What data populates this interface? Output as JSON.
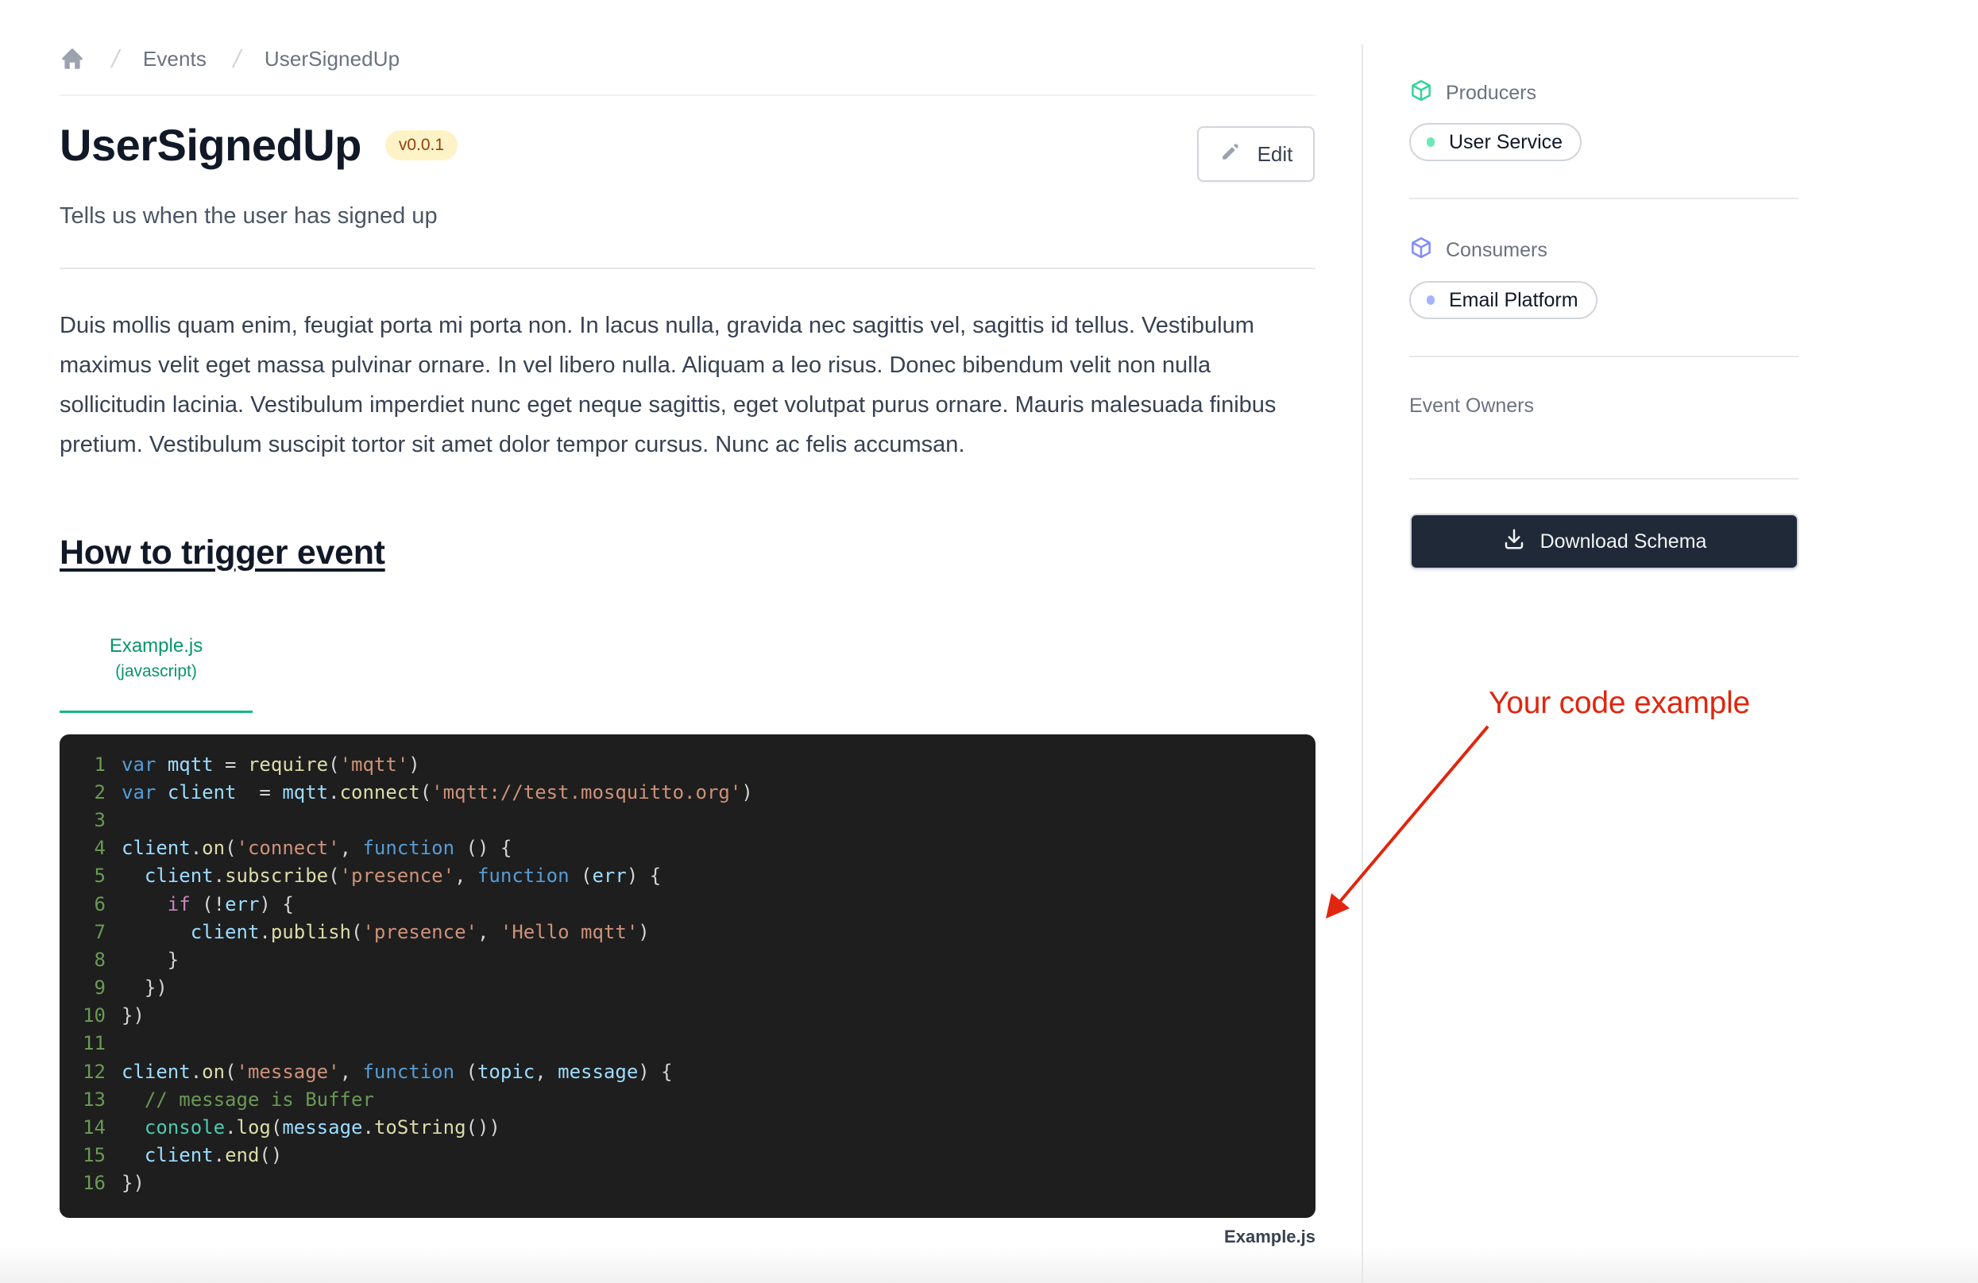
{
  "breadcrumb": {
    "home_icon": "home-icon",
    "separator": "/",
    "items": [
      "Events",
      "UserSignedUp"
    ]
  },
  "header": {
    "title": "UserSignedUp",
    "version": "v0.0.1",
    "edit_label": "Edit",
    "edit_icon": "pencil-icon",
    "summary": "Tells us when the user has signed up"
  },
  "body": {
    "paragraph": "Duis mollis quam enim, feugiat porta mi porta non. In lacus nulla, gravida nec sagittis vel, sagittis id tellus. Vestibulum maximus velit eget massa pulvinar ornare. In vel libero nulla. Aliquam a leo risus. Donec bibendum velit non nulla sollicitudin lacinia. Vestibulum imperdiet nunc eget neque sagittis, eget volutpat purus ornare. Mauris malesuada finibus pretium. Vestibulum suscipit tortor sit amet dolor tempor cursus. Nunc ac felis accumsan.",
    "section_heading": "How to trigger event"
  },
  "code_example": {
    "tab_name": "Example.js",
    "tab_language": "(javascript)",
    "caption": "Example.js",
    "lines": [
      [
        [
          "kw",
          "var"
        ],
        [
          "p",
          " "
        ],
        [
          "var",
          "mqtt"
        ],
        [
          "p",
          " = "
        ],
        [
          "fn",
          "require"
        ],
        [
          "p",
          "("
        ],
        [
          "str",
          "'mqtt'"
        ],
        [
          "p",
          ")"
        ]
      ],
      [
        [
          "kw",
          "var"
        ],
        [
          "p",
          " "
        ],
        [
          "var",
          "client"
        ],
        [
          "p",
          "  = "
        ],
        [
          "var",
          "mqtt"
        ],
        [
          "p",
          "."
        ],
        [
          "fn",
          "connect"
        ],
        [
          "p",
          "("
        ],
        [
          "str",
          "'mqtt://test.mosquitto.org'"
        ],
        [
          "p",
          ")"
        ]
      ],
      [],
      [
        [
          "var",
          "client"
        ],
        [
          "p",
          "."
        ],
        [
          "fn",
          "on"
        ],
        [
          "p",
          "("
        ],
        [
          "str",
          "'connect'"
        ],
        [
          "p",
          ", "
        ],
        [
          "kw",
          "function"
        ],
        [
          "p",
          " () {"
        ]
      ],
      [
        [
          "p",
          "  "
        ],
        [
          "var",
          "client"
        ],
        [
          "p",
          "."
        ],
        [
          "fn",
          "subscribe"
        ],
        [
          "p",
          "("
        ],
        [
          "str",
          "'presence'"
        ],
        [
          "p",
          ", "
        ],
        [
          "kw",
          "function"
        ],
        [
          "p",
          " ("
        ],
        [
          "var",
          "err"
        ],
        [
          "p",
          ") {"
        ]
      ],
      [
        [
          "p",
          "    "
        ],
        [
          "ctl",
          "if"
        ],
        [
          "p",
          " (!"
        ],
        [
          "var",
          "err"
        ],
        [
          "p",
          ") {"
        ]
      ],
      [
        [
          "p",
          "      "
        ],
        [
          "var",
          "client"
        ],
        [
          "p",
          "."
        ],
        [
          "fn",
          "publish"
        ],
        [
          "p",
          "("
        ],
        [
          "str",
          "'presence'"
        ],
        [
          "p",
          ", "
        ],
        [
          "str",
          "'Hello mqtt'"
        ],
        [
          "p",
          ")"
        ]
      ],
      [
        [
          "p",
          "    }"
        ]
      ],
      [
        [
          "p",
          "  })"
        ]
      ],
      [
        [
          "p",
          "})"
        ]
      ],
      [],
      [
        [
          "var",
          "client"
        ],
        [
          "p",
          "."
        ],
        [
          "fn",
          "on"
        ],
        [
          "p",
          "("
        ],
        [
          "str",
          "'message'"
        ],
        [
          "p",
          ", "
        ],
        [
          "kw",
          "function"
        ],
        [
          "p",
          " ("
        ],
        [
          "var",
          "topic"
        ],
        [
          "p",
          ", "
        ],
        [
          "var",
          "message"
        ],
        [
          "p",
          ") {"
        ]
      ],
      [
        [
          "p",
          "  "
        ],
        [
          "com",
          "// message is Buffer"
        ]
      ],
      [
        [
          "p",
          "  "
        ],
        [
          "cls",
          "console"
        ],
        [
          "p",
          "."
        ],
        [
          "fn",
          "log"
        ],
        [
          "p",
          "("
        ],
        [
          "var",
          "message"
        ],
        [
          "p",
          "."
        ],
        [
          "fn",
          "toString"
        ],
        [
          "p",
          "())"
        ]
      ],
      [
        [
          "p",
          "  "
        ],
        [
          "var",
          "client"
        ],
        [
          "p",
          "."
        ],
        [
          "fn",
          "end"
        ],
        [
          "p",
          "()"
        ]
      ],
      [
        [
          "p",
          "})"
        ]
      ]
    ]
  },
  "sidebar": {
    "producers": {
      "label": "Producers",
      "icon": "cube-icon",
      "color": "#34d399",
      "items": [
        {
          "label": "User Service",
          "dot_color": "#6ee7b7"
        }
      ]
    },
    "consumers": {
      "label": "Consumers",
      "icon": "cube-icon",
      "color": "#818cf8",
      "items": [
        {
          "label": "Email Platform",
          "dot_color": "#a5b4fc"
        }
      ]
    },
    "owners_label": "Event Owners",
    "download_label": "Download Schema",
    "download_icon": "download-icon"
  },
  "annotation": {
    "text": "Your code example",
    "color": "#e0260e"
  }
}
